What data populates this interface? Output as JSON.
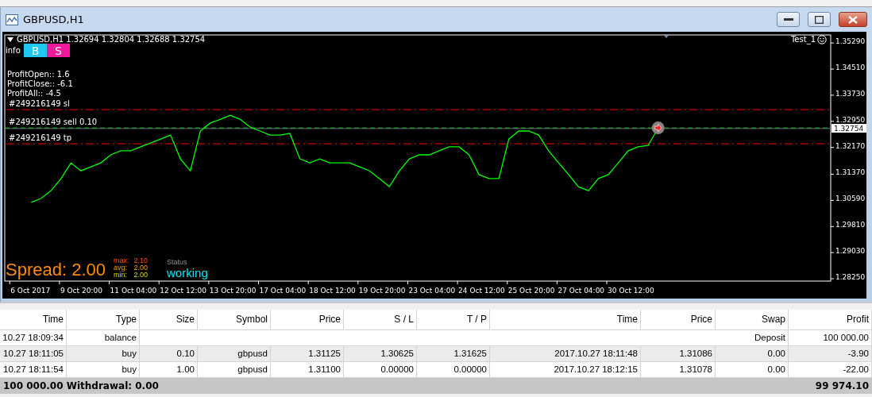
{
  "window": {
    "title": "GBPUSD,H1",
    "buttons": [
      {
        "kind": "minimize"
      },
      {
        "kind": "restore"
      },
      {
        "kind": "close"
      }
    ]
  },
  "chart": {
    "header": "GBPUSD,H1  1.32694 1.32804 1.32688 1.32754",
    "expert": "Test_1",
    "info_label": "info",
    "trade_buttons": [
      {
        "label": "B",
        "color": "#1ec8f0"
      },
      {
        "label": "S",
        "color": "#f0199a"
      }
    ],
    "profit_lines": [
      "ProfitOpen:: 1.6",
      "ProfitClose:: -6.1",
      "ProfitAll:: -4.5"
    ],
    "spread": {
      "text": "Spread: 2.00",
      "stats": [
        {
          "label": "max:",
          "value": "2.10"
        },
        {
          "label": "avg:",
          "value": "2.00"
        },
        {
          "label": "min:",
          "value": "2.00"
        }
      ]
    },
    "status": {
      "label": "Status",
      "value": "working"
    },
    "chart_data": {
      "type": "line",
      "ylim": [
        1.2818,
        1.3553
      ],
      "categories": [
        "6 Oct 2017",
        null,
        null,
        null,
        null,
        "9 Oct 20:00",
        null,
        null,
        null,
        null,
        "11 Oct 04:00",
        null,
        null,
        null,
        null,
        "12 Oct 12:00",
        null,
        null,
        null,
        null,
        "13 Oct 20:00",
        null,
        null,
        null,
        null,
        "17 Oct 04:00",
        null,
        null,
        null,
        null,
        "18 Oct 12:00",
        null,
        null,
        null,
        null,
        "19 Oct 20:00",
        null,
        null,
        null,
        null,
        "23 Oct 04:00",
        null,
        null,
        null,
        null,
        "24 Oct 12:00",
        null,
        null,
        null,
        null,
        "25 Oct 20:00",
        null,
        null,
        null,
        null,
        "27 Oct 04:00",
        null,
        null,
        null,
        null,
        "30 Oct 12:00",
        null,
        null,
        null,
        null,
        null,
        null,
        null,
        null,
        null,
        null,
        null,
        null,
        null,
        null,
        null,
        null,
        null,
        null,
        null,
        null,
        null,
        null
      ],
      "series": [
        {
          "color": "#00ff00",
          "values": [
            1.3053,
            1.3065,
            1.3088,
            1.3124,
            1.3171,
            1.3147,
            1.3159,
            1.3171,
            1.3195,
            1.3207,
            1.3207,
            1.3219,
            1.323,
            1.3242,
            1.3254,
            1.3183,
            1.3147,
            1.3266,
            1.329,
            1.3301,
            1.3313,
            1.3301,
            1.3278,
            1.3266,
            1.3254,
            1.3254,
            1.3259,
            1.3183,
            1.3171,
            1.3183,
            1.3171,
            1.3171,
            1.3171,
            1.3159,
            1.3147,
            1.3124,
            1.31,
            1.3147,
            1.3183,
            1.3195,
            1.3195,
            1.3207,
            1.3219,
            1.3219,
            1.3195,
            1.3136,
            1.3124,
            1.3124,
            1.3242,
            1.3266,
            1.3266,
            1.3254,
            1.3207,
            1.3171,
            1.3136,
            1.31,
            1.3088,
            1.3124,
            1.3136,
            1.3171,
            1.3207,
            1.3219,
            1.3223,
            1.3275,
            null,
            null,
            null,
            null,
            null,
            null,
            null,
            null,
            null,
            null,
            null,
            null,
            null,
            null,
            null,
            null,
            null,
            null,
            null
          ]
        }
      ],
      "yticks": [
        {
          "value": 1.3529,
          "label": "1.35290"
        },
        {
          "value": 1.3451,
          "label": "1.34510"
        },
        {
          "value": 1.3373,
          "label": "1.33730"
        },
        {
          "value": 1.3295,
          "label": "1.32950"
        },
        {
          "value": 1.3217,
          "label": "1.32170"
        },
        {
          "value": 1.3137,
          "label": "1.31370"
        },
        {
          "value": 1.3059,
          "label": "1.30590"
        },
        {
          "value": 1.2981,
          "label": "1.29810"
        },
        {
          "value": 1.2903,
          "label": "1.29030"
        },
        {
          "value": 1.2825,
          "label": "1.28250"
        }
      ],
      "ref_lines": [
        {
          "axis": "y",
          "value": 1.333,
          "label": "#249216149 sl",
          "color": "#ff0000"
        },
        {
          "axis": "y",
          "value": 1.32754,
          "label": "#249216149 sell 0.10",
          "color": "#00c800"
        },
        {
          "axis": "y",
          "value": 1.32754,
          "label": "1.32754",
          "color": "#8090a0"
        },
        {
          "axis": "y",
          "value": 1.3228,
          "label": "#249216149 tp",
          "color": "#ff0000"
        }
      ]
    }
  },
  "table": {
    "columns": [
      "Time",
      "Type",
      "Size",
      "Symbol",
      "Price",
      "S / L",
      "T / P",
      "Time",
      "Price",
      "Swap",
      "Profit"
    ],
    "rows": [
      {
        "kind": "balance",
        "time": "10.27 18:09:34",
        "type": "balance",
        "comment": "Deposit",
        "profit": "100 000.00"
      },
      {
        "kind": "trade",
        "cells": [
          "10.27 18:11:05",
          "buy",
          "0.10",
          "gbpusd",
          "1.31125",
          "1.30625",
          "1.31625",
          "2017.10.27 18:11:48",
          "1.31086",
          "0.00",
          "-3.90"
        ]
      },
      {
        "kind": "trade",
        "cells": [
          "10.27 18:11:54",
          "buy",
          "1.00",
          "gbpusd",
          "1.31100",
          "0.00000",
          "0.00000",
          "2017.10.27 18:12:15",
          "1.31078",
          "0.00",
          "-22.00"
        ]
      }
    ],
    "footer": {
      "summary": "100 000.00  Withdrawal: 0.00",
      "total": "99 974.10"
    }
  }
}
